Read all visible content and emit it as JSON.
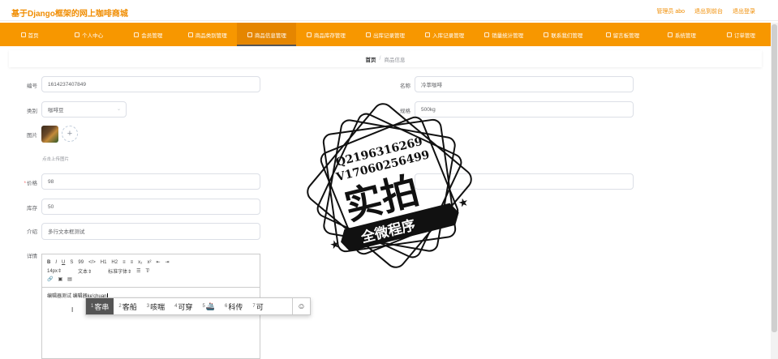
{
  "header": {
    "site_title": "基于Django框架的网上咖啡商城",
    "links": [
      "管理员 abo",
      "退出到前台",
      "退出登录"
    ]
  },
  "nav": {
    "items": [
      "首页",
      "个人中心",
      "会员管理",
      "商品类别管理",
      "商品信息管理",
      "商品库存管理",
      "出库记录管理",
      "入库记录管理",
      "销量统计管理",
      "联系我们管理",
      "留言板管理",
      "系统管理",
      "订单管理"
    ],
    "active_index": 4
  },
  "breadcrumb": {
    "home": "首页",
    "sep": "/",
    "current": "商品信息"
  },
  "form": {
    "code_label": "编号",
    "code_value": "1614237407849",
    "name_label": "名称",
    "name_value": "冷萃咖啡",
    "category_label": "类别",
    "category_value": "咖啡豆",
    "spec_label": "规格",
    "spec_value": "500kg",
    "image_label": "图片",
    "upload_hint": "点击上传图片",
    "price_label": "价格",
    "price_value": "98",
    "stock_label": "库存",
    "stock_value": "50",
    "intro_label": "介绍",
    "intro_value": "多行文本框测试",
    "detail_label": "详情"
  },
  "editor": {
    "row1": [
      "B",
      "I",
      "U",
      "S",
      "99",
      "</>",
      "H1",
      "H2",
      "≡",
      "≡",
      "x₂",
      "x²",
      "⇤",
      "⇥"
    ],
    "font_size": "14px",
    "para": "文本",
    "font": "标准字体",
    "text": "编辑器测试 编辑器",
    "composition": "ke'chuan"
  },
  "ime": {
    "candidates": [
      {
        "n": "1",
        "text": "客串"
      },
      {
        "n": "2",
        "text": "客船"
      },
      {
        "n": "3",
        "text": "咳喘"
      },
      {
        "n": "4",
        "text": "可穿"
      },
      {
        "n": "5",
        "text": "🚢"
      },
      {
        "n": "6",
        "text": "科传"
      },
      {
        "n": "7",
        "text": "可"
      }
    ],
    "emoji_button": "☺"
  },
  "watermark": {
    "line1": "Q2196316269",
    "line2": "V17060256499",
    "big": "实拍",
    "banner": "全微程序"
  },
  "colors": {
    "brand": "#f79700",
    "title": "#f08c00"
  }
}
